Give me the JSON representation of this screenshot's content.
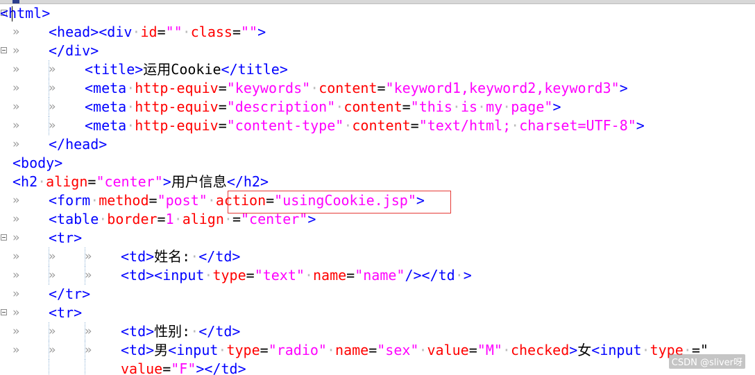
{
  "editor": {
    "lines": [
      [
        [
          "t",
          "<html>"
        ]
      ],
      [
        [
          "t",
          "<head><div"
        ],
        [
          "d",
          "·"
        ],
        [
          "a",
          "id"
        ],
        [
          "x",
          "="
        ],
        [
          "v",
          "\"\""
        ],
        [
          "d",
          "·"
        ],
        [
          "a",
          "class"
        ],
        [
          "x",
          "="
        ],
        [
          "v",
          "\"\""
        ],
        [
          "t",
          ">"
        ]
      ],
      [
        [
          "t",
          "</div>"
        ]
      ],
      [
        [
          "t",
          "<title>"
        ],
        [
          "x",
          "运用Cookie"
        ],
        [
          "t",
          "</title>"
        ]
      ],
      [
        [
          "t",
          "<meta"
        ],
        [
          "d",
          "·"
        ],
        [
          "a",
          "http-equiv"
        ],
        [
          "x",
          "="
        ],
        [
          "v",
          "\"keywords\""
        ],
        [
          "d",
          "·"
        ],
        [
          "a",
          "content"
        ],
        [
          "x",
          "="
        ],
        [
          "v",
          "\"keyword1,keyword2,keyword3\""
        ],
        [
          "t",
          ">"
        ]
      ],
      [
        [
          "t",
          "<meta"
        ],
        [
          "d",
          "·"
        ],
        [
          "a",
          "http-equiv"
        ],
        [
          "x",
          "="
        ],
        [
          "v",
          "\"description\""
        ],
        [
          "d",
          "·"
        ],
        [
          "a",
          "content"
        ],
        [
          "x",
          "="
        ],
        [
          "v",
          "\"this"
        ],
        [
          "d",
          "·"
        ],
        [
          "v",
          "is"
        ],
        [
          "d",
          "·"
        ],
        [
          "v",
          "my"
        ],
        [
          "d",
          "·"
        ],
        [
          "v",
          "page\""
        ],
        [
          "t",
          ">"
        ]
      ],
      [
        [
          "t",
          "<meta"
        ],
        [
          "d",
          "·"
        ],
        [
          "a",
          "http-equiv"
        ],
        [
          "x",
          "="
        ],
        [
          "v",
          "\"content-type\""
        ],
        [
          "d",
          "·"
        ],
        [
          "a",
          "content"
        ],
        [
          "x",
          "="
        ],
        [
          "v",
          "\"text/html;"
        ],
        [
          "d",
          "·"
        ],
        [
          "v",
          "charset=UTF-8\""
        ],
        [
          "t",
          ">"
        ]
      ],
      [
        [
          "t",
          "</head>"
        ]
      ],
      [
        [
          "t",
          "<body>"
        ]
      ],
      [
        [
          "t",
          "<h2"
        ],
        [
          "d",
          "·"
        ],
        [
          "a",
          "align"
        ],
        [
          "x",
          "="
        ],
        [
          "v",
          "\"center\""
        ],
        [
          "t",
          ">"
        ],
        [
          "x",
          "用户信息"
        ],
        [
          "t",
          "</h2>"
        ]
      ],
      [
        [
          "t",
          "<form"
        ],
        [
          "d",
          "·"
        ],
        [
          "a",
          "method"
        ],
        [
          "x",
          "="
        ],
        [
          "v",
          "\"post\""
        ],
        [
          "d",
          "·"
        ],
        [
          "a",
          "action"
        ],
        [
          "x",
          "="
        ],
        [
          "v",
          "\"usingCookie.jsp\""
        ],
        [
          "t",
          ">"
        ]
      ],
      [
        [
          "t",
          "<table"
        ],
        [
          "d",
          "·"
        ],
        [
          "a",
          "border"
        ],
        [
          "x",
          "="
        ],
        [
          "v",
          "1"
        ],
        [
          "d",
          "·"
        ],
        [
          "a",
          "align"
        ],
        [
          "d",
          "·"
        ],
        [
          "x",
          "="
        ],
        [
          "v",
          "\"center\""
        ],
        [
          "t",
          ">"
        ]
      ],
      [
        [
          "t",
          "<tr>"
        ]
      ],
      [
        [
          "t",
          "<td>"
        ],
        [
          "x",
          "姓名:"
        ],
        [
          "d",
          "·"
        ],
        [
          "t",
          "</td>"
        ]
      ],
      [
        [
          "t",
          "<td><input"
        ],
        [
          "d",
          "·"
        ],
        [
          "a",
          "type"
        ],
        [
          "x",
          "="
        ],
        [
          "v",
          "\"text\""
        ],
        [
          "d",
          "·"
        ],
        [
          "a",
          "name"
        ],
        [
          "x",
          "="
        ],
        [
          "v",
          "\"name\""
        ],
        [
          "t",
          "/></td"
        ],
        [
          "d",
          "·"
        ],
        [
          "t",
          ">"
        ]
      ],
      [
        [
          "t",
          "</tr>"
        ]
      ],
      [
        [
          "t",
          "<tr>"
        ]
      ],
      [
        [
          "t",
          "<td>"
        ],
        [
          "x",
          "性别:"
        ],
        [
          "d",
          "·"
        ],
        [
          "t",
          "</td>"
        ]
      ],
      [
        [
          "t",
          "<td>"
        ],
        [
          "x",
          "男"
        ],
        [
          "t",
          "<input"
        ],
        [
          "d",
          "·"
        ],
        [
          "a",
          "type"
        ],
        [
          "x",
          "="
        ],
        [
          "v",
          "\"radio\""
        ],
        [
          "d",
          "·"
        ],
        [
          "a",
          "name"
        ],
        [
          "x",
          "="
        ],
        [
          "v",
          "\"sex\""
        ],
        [
          "d",
          "·"
        ],
        [
          "a",
          "value"
        ],
        [
          "x",
          "="
        ],
        [
          "v",
          "\"M\""
        ],
        [
          "d",
          "·"
        ],
        [
          "a",
          "checked"
        ],
        [
          "t",
          ">"
        ],
        [
          "x",
          "女"
        ],
        [
          "t",
          "<input"
        ],
        [
          "d",
          "·"
        ],
        [
          "a",
          "type"
        ],
        [
          "d",
          "·"
        ],
        [
          "x",
          "=\""
        ]
      ],
      [
        [
          "a",
          "value"
        ],
        [
          "x",
          "="
        ],
        [
          "v",
          "\"F\""
        ],
        [
          "t",
          "></td>"
        ]
      ]
    ]
  },
  "watermark": "CSDN @sliver呀"
}
